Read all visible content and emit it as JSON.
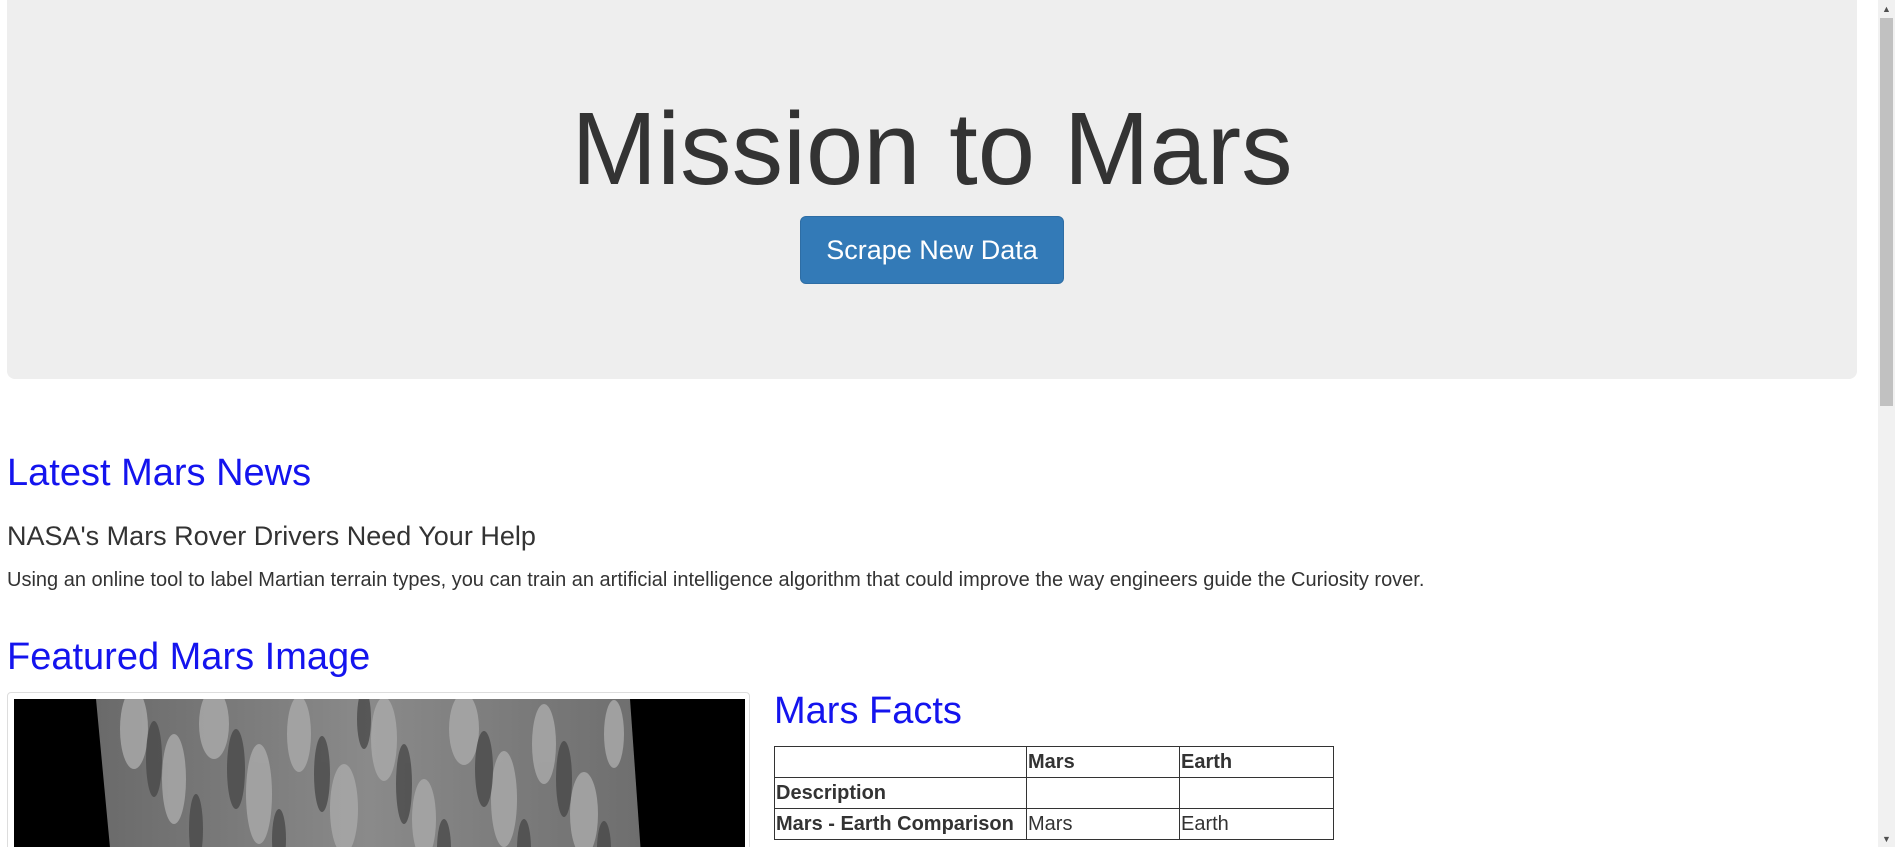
{
  "header": {
    "title": "Mission to Mars",
    "scrape_button_label": "Scrape New Data"
  },
  "news": {
    "heading": "Latest Mars News",
    "title": "NASA's Mars Rover Drivers Need Your Help",
    "teaser": "Using an online tool to label Martian terrain types, you can train an artificial intelligence algorithm that could improve the way engineers guide the Curiosity rover."
  },
  "featured_image": {
    "heading": "Featured Mars Image"
  },
  "facts": {
    "heading": "Mars Facts",
    "columns": [
      "",
      "Mars",
      "Earth"
    ],
    "rows": [
      {
        "label": "Description",
        "mars": "",
        "earth": ""
      },
      {
        "label": "Mars - Earth Comparison",
        "mars": "Mars",
        "earth": "Earth"
      }
    ]
  },
  "scrollbar": {
    "up_icon": "triangle-up-icon",
    "down_icon": "triangle-down-icon"
  },
  "colors": {
    "jumbotron_bg": "#eeeeee",
    "button_bg": "#337ab7",
    "heading_link": "#1414ee",
    "text": "#333333"
  }
}
